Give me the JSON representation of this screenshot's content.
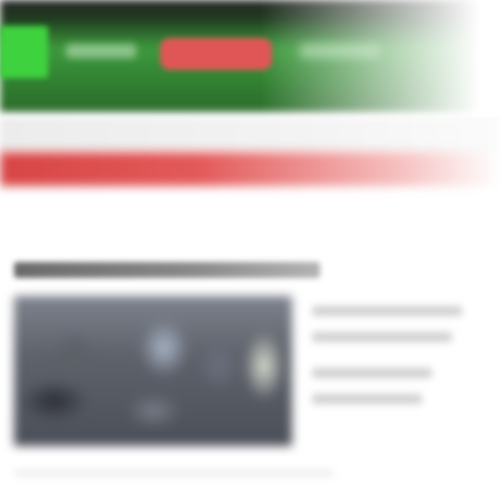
{
  "header": {
    "logo_icon": "site-logo-icon",
    "button_label": "",
    "colors": {
      "header_dark": "#262626",
      "header_green": "#3d9a3d",
      "logo_green": "#3fd23f",
      "button_red": "#e05656"
    }
  },
  "banner": {
    "text": "",
    "color": "#d84545"
  },
  "article": {
    "title": "",
    "excerpt": ""
  }
}
